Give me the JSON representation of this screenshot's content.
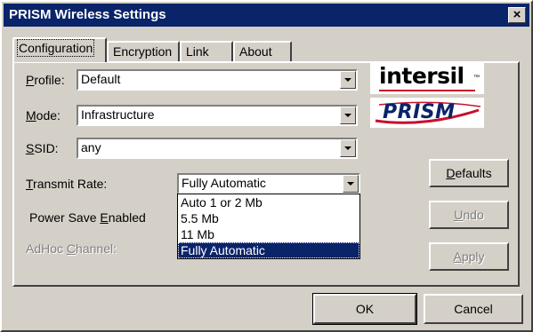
{
  "window": {
    "title": "PRISM Wireless Settings",
    "close_glyph": "×"
  },
  "tabs": [
    {
      "label": "Configuration"
    },
    {
      "label": "Encryption"
    },
    {
      "label": "Link"
    },
    {
      "label": "About"
    }
  ],
  "form": {
    "profile": {
      "label_u": "P",
      "label_rest": "rofile:",
      "value": "Default"
    },
    "mode": {
      "label_u": "M",
      "label_rest": "ode:",
      "value": "Infrastructure"
    },
    "ssid": {
      "label_u": "S",
      "label_rest": "SID:",
      "value": "any"
    },
    "transmit_rate": {
      "label_u": "T",
      "label_rest": "ransmit Rate:",
      "value": "Fully Automatic"
    },
    "power_save": {
      "label_pre": "Power Save ",
      "label_u": "E",
      "label_rest": "nabled"
    },
    "adhoc": {
      "label_pre": "AdHoc ",
      "label_u": "C",
      "label_rest": "hannel:"
    }
  },
  "transmit_rate_options": [
    "Auto 1 or 2 Mb",
    "5.5 Mb",
    "11 Mb",
    "Fully Automatic"
  ],
  "logos": {
    "intersil": "intersil",
    "intersil_mark": "™",
    "prism": "PRISM"
  },
  "buttons": {
    "defaults": {
      "u": "D",
      "rest": "efaults"
    },
    "undo": {
      "u": "U",
      "rest": "ndo"
    },
    "apply": {
      "u": "A",
      "rest": "pply"
    },
    "ok": "OK",
    "cancel": "Cancel"
  },
  "colors": {
    "titlebar": "#0a246a",
    "face": "#d4d0c8",
    "prism_red": "#c8102e"
  }
}
